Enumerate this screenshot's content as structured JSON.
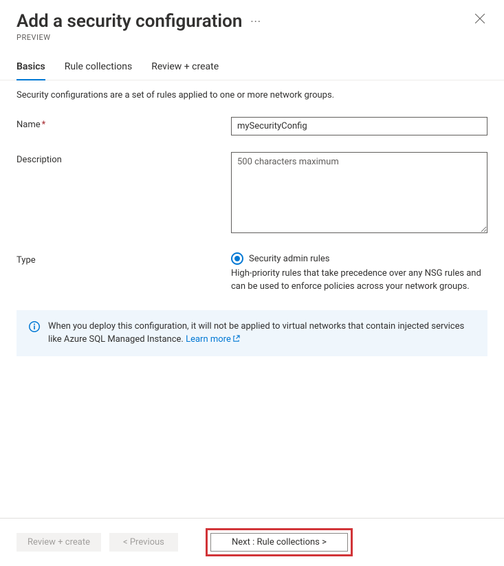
{
  "header": {
    "title": "Add a security configuration",
    "preview": "PREVIEW"
  },
  "tabs": {
    "basics": "Basics",
    "rule_collections": "Rule collections",
    "review_create": "Review + create"
  },
  "content": {
    "intro": "Security configurations are a set of rules applied to one or more network groups.",
    "name": {
      "label": "Name",
      "value": "mySecurityConfig"
    },
    "description": {
      "label": "Description",
      "placeholder": "500 characters maximum"
    },
    "type": {
      "label": "Type",
      "option_label": "Security admin rules",
      "option_help": "High-priority rules that take precedence over any NSG rules and can be used to enforce policies across your network groups."
    },
    "info": {
      "text": "When you deploy this configuration, it will not be applied to virtual networks that contain injected services like Azure SQL Managed Instance. ",
      "link_text": "Learn more"
    }
  },
  "footer": {
    "review_create": "Review + create",
    "previous": "< Previous",
    "next": "Next : Rule collections >"
  }
}
